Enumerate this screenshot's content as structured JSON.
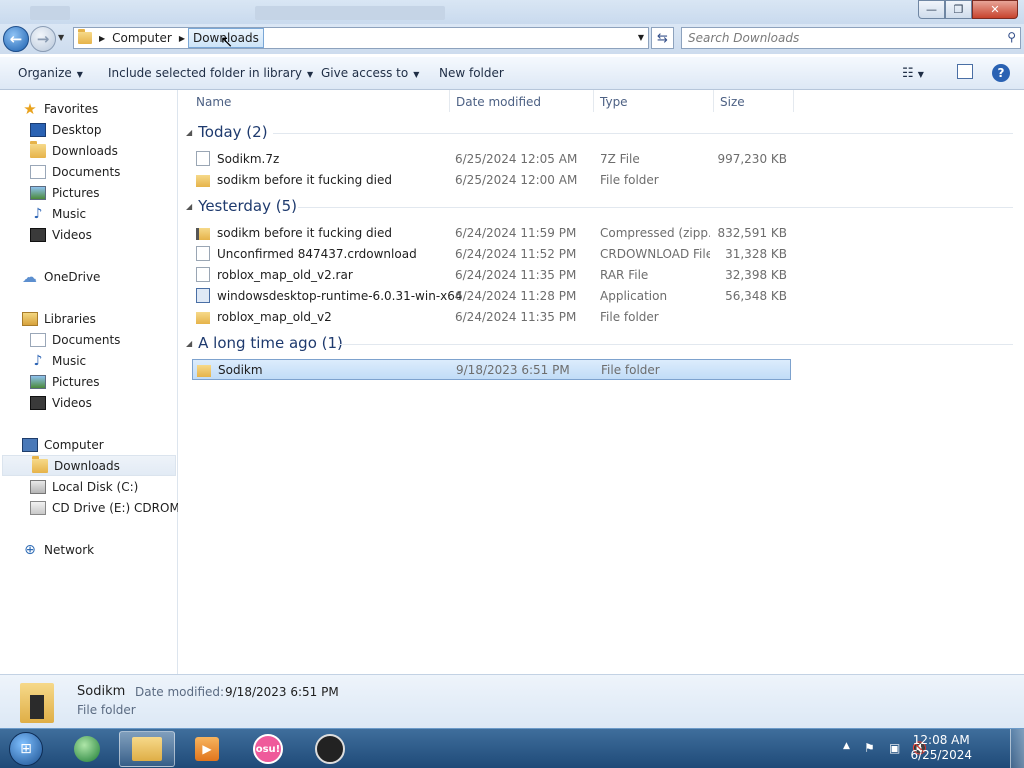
{
  "window": {
    "minimize_label": "—",
    "maximize_label": "❐",
    "close_label": "✕"
  },
  "nav": {
    "back_glyph": "←",
    "forward_glyph": "→",
    "breadcrumb": [
      "Computer",
      "Downloads"
    ],
    "search_placeholder": "Search Downloads"
  },
  "toolbar": {
    "organize": "Organize",
    "include_library": "Include selected folder in library",
    "give_access": "Give access to",
    "new_folder": "New folder"
  },
  "sidebar": {
    "favorites": {
      "label": "Favorites",
      "items": [
        "Desktop",
        "Downloads",
        "Documents",
        "Pictures",
        "Music",
        "Videos"
      ]
    },
    "onedrive": "OneDrive",
    "libraries": {
      "label": "Libraries",
      "items": [
        "Documents",
        "Music",
        "Pictures",
        "Videos"
      ]
    },
    "computer": {
      "label": "Computer",
      "items": [
        "Downloads",
        "Local Disk (C:)",
        "CD Drive (E:) CDROM"
      ]
    },
    "network": "Network"
  },
  "columns": {
    "name": "Name",
    "date": "Date modified",
    "type": "Type",
    "size": "Size"
  },
  "groups": [
    {
      "title": "Today (2)",
      "rows": [
        {
          "name": "Sodikm.7z",
          "date": "6/25/2024 12:05 AM",
          "type": "7Z File",
          "size": "997,230 KB",
          "icon": "file-icon"
        },
        {
          "name": "sodikm before it fucking died",
          "date": "6/25/2024 12:00 AM",
          "type": "File folder",
          "size": "",
          "icon": "folder-icon"
        }
      ]
    },
    {
      "title": "Yesterday (5)",
      "rows": [
        {
          "name": "sodikm before it fucking died",
          "date": "6/24/2024 11:59 PM",
          "type": "Compressed (zipp...",
          "size": "832,591 KB",
          "icon": "zip-folder-icon"
        },
        {
          "name": "Unconfirmed 847437.crdownload",
          "date": "6/24/2024 11:52 PM",
          "type": "CRDOWNLOAD File",
          "size": "31,328 KB",
          "icon": "file-icon"
        },
        {
          "name": "roblox_map_old_v2.rar",
          "date": "6/24/2024 11:35 PM",
          "type": "RAR File",
          "size": "32,398 KB",
          "icon": "file-icon"
        },
        {
          "name": "windowsdesktop-runtime-6.0.31-win-x64",
          "date": "6/24/2024 11:28 PM",
          "type": "Application",
          "size": "56,348 KB",
          "icon": "app-icon"
        },
        {
          "name": "roblox_map_old_v2",
          "date": "6/24/2024 11:35 PM",
          "type": "File folder",
          "size": "",
          "icon": "folder-icon"
        }
      ]
    },
    {
      "title": "A long time ago (1)",
      "rows": [
        {
          "name": "Sodikm",
          "date": "9/18/2023 6:51 PM",
          "type": "File folder",
          "size": "",
          "icon": "folder-icon",
          "selected": true
        }
      ]
    }
  ],
  "details": {
    "name": "Sodikm",
    "date_label": "Date modified:",
    "date_value": "9/18/2023 6:51 PM",
    "type": "File folder"
  },
  "taskbar": {
    "osu_label": "osu!",
    "time": "12:08 AM",
    "date": "6/25/2024"
  },
  "colors": {
    "accent": "#1e3a6e",
    "selection": "#c1dcf7",
    "taskbar": "#1f4a78"
  }
}
